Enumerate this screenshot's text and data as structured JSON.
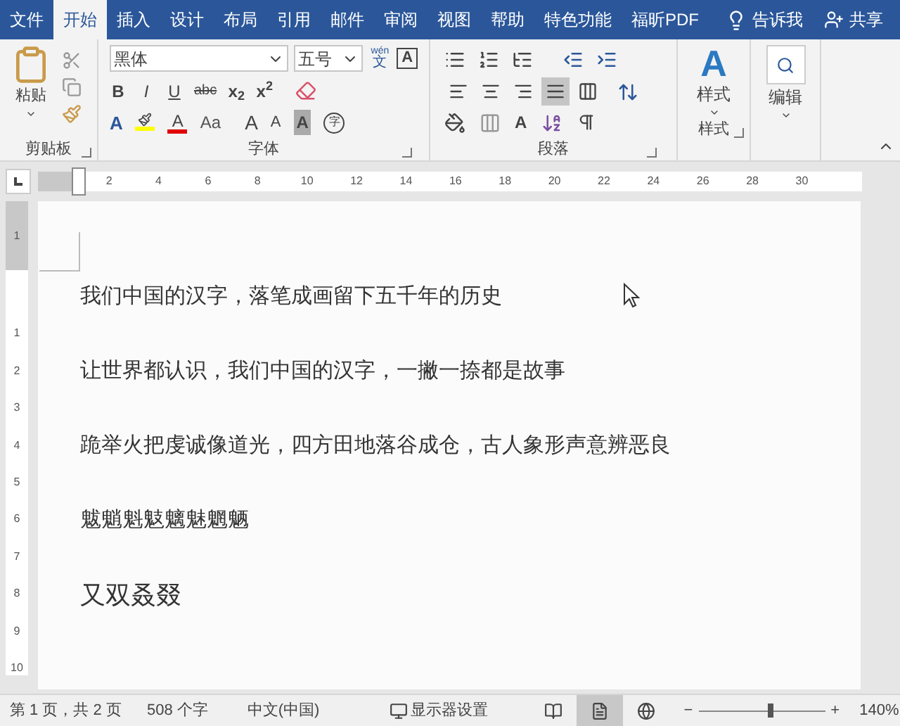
{
  "tabs": [
    {
      "label": "文件",
      "selected": false
    },
    {
      "label": "开始",
      "selected": true
    },
    {
      "label": "插入",
      "selected": false
    },
    {
      "label": "设计",
      "selected": false
    },
    {
      "label": "布局",
      "selected": false
    },
    {
      "label": "引用",
      "selected": false
    },
    {
      "label": "邮件",
      "selected": false
    },
    {
      "label": "审阅",
      "selected": false
    },
    {
      "label": "视图",
      "selected": false
    },
    {
      "label": "帮助",
      "selected": false
    },
    {
      "label": "特色功能",
      "selected": false
    },
    {
      "label": "福昕PDF",
      "selected": false
    }
  ],
  "tell_me": "告诉我",
  "share": "共享",
  "clipboard": {
    "paste": "粘贴",
    "label": "剪贴板"
  },
  "font": {
    "font_name": "黑体",
    "font_size": "五号",
    "label": "字体",
    "phonetic": {
      "top": "wén",
      "bottom": "文"
    },
    "border": "A",
    "format_buttons": [
      {
        "kind": "bold",
        "text": "B"
      },
      {
        "kind": "italic",
        "text": "I"
      },
      {
        "kind": "underline",
        "text": "U"
      },
      {
        "kind": "strike",
        "text": "abc"
      },
      {
        "kind": "plain",
        "text": "x$_{2}$"
      },
      {
        "kind": "plain",
        "text": "x$^{2}$"
      }
    ],
    "effects": "A",
    "font_color": "A",
    "change_case": "Aa",
    "grow": "A",
    "shrink": "A",
    "shading": "A",
    "enclose": "字"
  },
  "paragraph": {
    "label": "段落",
    "asian_layout": "A",
    "align": [
      {
        "selected": false
      },
      {
        "selected": false
      },
      {
        "selected": false
      },
      {
        "selected": true
      },
      {
        "selected": false
      }
    ]
  },
  "styles": {
    "glyph": "A",
    "button": "样式",
    "label": "样式"
  },
  "editing": {
    "button": "编辑"
  },
  "ruler": {
    "horizontal": [
      "2",
      "4",
      "6",
      "8",
      "10",
      "12",
      "14",
      "16",
      "18",
      "20",
      "22",
      "24",
      "26",
      "28",
      "30"
    ],
    "vertical": [
      "1",
      "1",
      "2",
      "3",
      "4",
      "5",
      "6",
      "7",
      "8",
      "9",
      "10"
    ]
  },
  "document": {
    "paragraphs": [
      {
        "kind": "body",
        "text": "我们中国的汉字，落笔成画留下五千年的历史"
      },
      {
        "kind": "body",
        "text": "让世界都认识，我们中国的汉字，一撇一捺都是故事"
      },
      {
        "kind": "body",
        "text": "跪举火把虔诚像道光，四方田地落谷成仓，古人象形声意辨恶良"
      },
      {
        "kind": "body",
        "text": "魃魈魁鬾魑魅魍魉"
      },
      {
        "kind": "large",
        "text": "又双叒叕"
      }
    ]
  },
  "status": {
    "page": "第 1 页，共 2 页",
    "words": "508 个字",
    "language": "中文(中国)",
    "display": "显示器设置",
    "views": [
      {
        "selected": false
      },
      {
        "selected": true
      },
      {
        "selected": false
      }
    ],
    "zoom": {
      "minus": "−",
      "level": 0.57,
      "plus": "+",
      "reading": "140%"
    }
  }
}
